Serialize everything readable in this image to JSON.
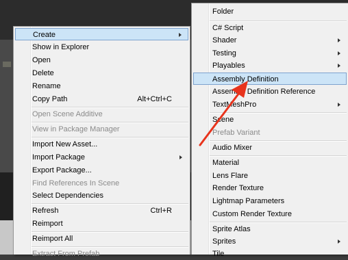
{
  "context_menu": {
    "items": [
      {
        "label": "Create",
        "shortcut": "",
        "submenu": true,
        "state": "hover"
      },
      {
        "label": "Show in Explorer",
        "shortcut": "",
        "submenu": false,
        "state": "normal"
      },
      {
        "label": "Open",
        "shortcut": "",
        "submenu": false,
        "state": "normal"
      },
      {
        "label": "Delete",
        "shortcut": "",
        "submenu": false,
        "state": "normal"
      },
      {
        "label": "Rename",
        "shortcut": "",
        "submenu": false,
        "state": "normal"
      },
      {
        "label": "Copy Path",
        "shortcut": "Alt+Ctrl+C",
        "submenu": false,
        "state": "normal"
      },
      {
        "label": "Open Scene Additive",
        "shortcut": "",
        "submenu": false,
        "state": "disabled"
      },
      {
        "label": "View in Package Manager",
        "shortcut": "",
        "submenu": false,
        "state": "disabled"
      },
      {
        "label": "Import New Asset...",
        "shortcut": "",
        "submenu": false,
        "state": "normal"
      },
      {
        "label": "Import Package",
        "shortcut": "",
        "submenu": true,
        "state": "normal"
      },
      {
        "label": "Export Package...",
        "shortcut": "",
        "submenu": false,
        "state": "normal"
      },
      {
        "label": "Find References In Scene",
        "shortcut": "",
        "submenu": false,
        "state": "disabled"
      },
      {
        "label": "Select Dependencies",
        "shortcut": "",
        "submenu": false,
        "state": "normal"
      },
      {
        "label": "Refresh",
        "shortcut": "Ctrl+R",
        "submenu": false,
        "state": "normal"
      },
      {
        "label": "Reimport",
        "shortcut": "",
        "submenu": false,
        "state": "normal"
      },
      {
        "label": "Reimport All",
        "shortcut": "",
        "submenu": false,
        "state": "normal"
      },
      {
        "label": "Extract From Prefab",
        "shortcut": "",
        "submenu": false,
        "state": "disabled"
      }
    ]
  },
  "create_submenu": {
    "items": [
      {
        "label": "Folder",
        "submenu": false,
        "state": "normal"
      },
      {
        "label": "C# Script",
        "submenu": false,
        "state": "normal"
      },
      {
        "label": "Shader",
        "submenu": true,
        "state": "normal"
      },
      {
        "label": "Testing",
        "submenu": true,
        "state": "normal"
      },
      {
        "label": "Playables",
        "submenu": true,
        "state": "normal"
      },
      {
        "label": "Assembly Definition",
        "submenu": false,
        "state": "highlighted"
      },
      {
        "label": "Assembly Definition Reference",
        "submenu": false,
        "state": "normal"
      },
      {
        "label": "TextMeshPro",
        "submenu": true,
        "state": "normal"
      },
      {
        "label": "Scene",
        "submenu": false,
        "state": "normal"
      },
      {
        "label": "Prefab Variant",
        "submenu": false,
        "state": "disabled"
      },
      {
        "label": "Audio Mixer",
        "submenu": false,
        "state": "normal"
      },
      {
        "label": "Material",
        "submenu": false,
        "state": "normal"
      },
      {
        "label": "Lens Flare",
        "submenu": false,
        "state": "normal"
      },
      {
        "label": "Render Texture",
        "submenu": false,
        "state": "normal"
      },
      {
        "label": "Lightmap Parameters",
        "submenu": false,
        "state": "normal"
      },
      {
        "label": "Custom Render Texture",
        "submenu": false,
        "state": "normal"
      },
      {
        "label": "Sprite Atlas",
        "submenu": false,
        "state": "normal"
      },
      {
        "label": "Sprites",
        "submenu": true,
        "state": "normal"
      },
      {
        "label": "Tile",
        "submenu": false,
        "state": "normal"
      }
    ]
  },
  "annotation": {
    "type": "arrow",
    "color": "#e8331c"
  },
  "colors": {
    "menu_bg": "#f0f0f0",
    "highlight_bg": "#cce4f7",
    "highlight_border": "#7da2ce",
    "disabled_text": "#8a8a8a"
  }
}
